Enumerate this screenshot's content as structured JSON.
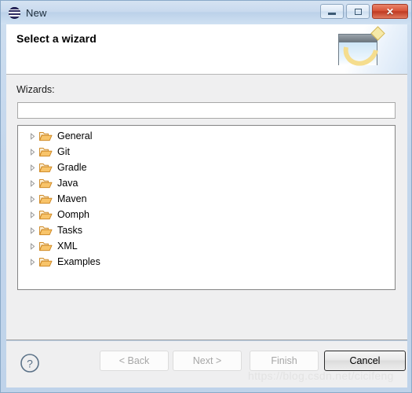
{
  "window": {
    "title": "New",
    "icon": "eclipse-icon",
    "controls": {
      "minimize_label": "",
      "maximize_label": "",
      "close_label": "✕"
    }
  },
  "header": {
    "title": "Select a wizard",
    "banner_icon": "wizard-banner-icon"
  },
  "content": {
    "wizards_label": "Wizards:",
    "filter": {
      "value": "",
      "placeholder": ""
    },
    "tree_items": [
      {
        "label": "General",
        "expanded": false,
        "icon": "folder-icon"
      },
      {
        "label": "Git",
        "expanded": false,
        "icon": "folder-icon"
      },
      {
        "label": "Gradle",
        "expanded": false,
        "icon": "folder-icon"
      },
      {
        "label": "Java",
        "expanded": false,
        "icon": "folder-icon"
      },
      {
        "label": "Maven",
        "expanded": false,
        "icon": "folder-icon"
      },
      {
        "label": "Oomph",
        "expanded": false,
        "icon": "folder-icon"
      },
      {
        "label": "Tasks",
        "expanded": false,
        "icon": "folder-icon"
      },
      {
        "label": "XML",
        "expanded": false,
        "icon": "folder-icon"
      },
      {
        "label": "Examples",
        "expanded": false,
        "icon": "folder-icon"
      }
    ]
  },
  "buttons": {
    "help_icon": "help-question-icon",
    "back": "< Back",
    "next": "Next >",
    "finish": "Finish",
    "cancel": "Cancel"
  },
  "watermark": "https://blog.csdn.net/cicifeng",
  "colors": {
    "window_frame": "#bfd3ea",
    "titlebar": "#c9daee",
    "panel_bg": "#efeff0",
    "close_button": "#d8553a",
    "folder_icon": "#e8a33d",
    "help_icon": "#5b7288",
    "disabled_text": "#a6a6a6"
  }
}
